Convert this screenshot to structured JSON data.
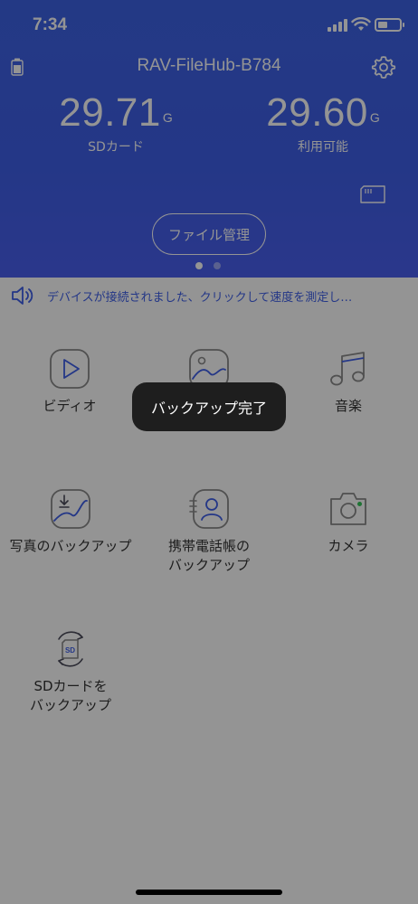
{
  "status_bar": {
    "time": "7:34"
  },
  "header": {
    "device_name": "RAV-FileHub-B784",
    "stats": [
      {
        "value": "29.71",
        "unit": "G",
        "label": "SDカード"
      },
      {
        "value": "29.60",
        "unit": "G",
        "label": "利用可能"
      }
    ],
    "file_manager_button": "ファイル管理"
  },
  "notice": {
    "text": "デバイスが接続されました、クリックして速度を測定し…"
  },
  "grid": {
    "video": "ビディオ",
    "music": "音楽",
    "photo_backup": "写真のバックアップ",
    "contacts_backup_line1": "携帯電話帳の",
    "contacts_backup_line2": "バックアップ",
    "camera": "カメラ",
    "sd_backup_line1": "SDカードを",
    "sd_backup_line2": "バックアップ",
    "sd_icon_text": "SD"
  },
  "toast": {
    "text": "バックアップ完了"
  },
  "colors": {
    "accent": "#3f5fe8",
    "icon_gray": "#8a8a8a",
    "icon_dark": "#4a4a5a",
    "camera_dot": "#34c759",
    "overlay": "rgba(0,0,0,0.42)"
  }
}
